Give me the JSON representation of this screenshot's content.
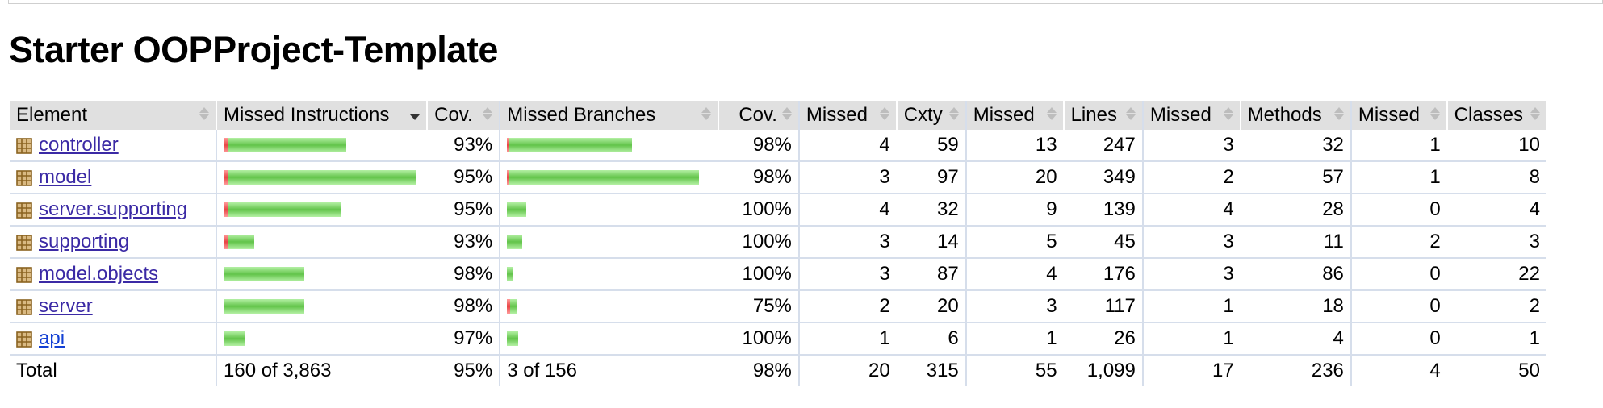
{
  "title": "Starter OOPProject-Template",
  "headers": {
    "element": "Element",
    "missed_instructions": "Missed Instructions",
    "cov1": "Cov.",
    "missed_branches": "Missed Branches",
    "cov2": "Cov.",
    "missed_cxty": "Missed",
    "cxty": "Cxty",
    "missed_lines": "Missed",
    "lines": "Lines",
    "missed_methods": "Missed",
    "methods": "Methods",
    "missed_classes": "Missed",
    "classes": "Classes"
  },
  "rows": [
    {
      "name": "controller",
      "instr_missed_frac": 0.06,
      "instr_total": 3863,
      "instr_cov": "93%",
      "br_missed_frac": 0.02,
      "br_total": 156,
      "br_cov": "98%",
      "missed_cxty": "4",
      "cxty": "59",
      "missed_lines": "13",
      "lines": "247",
      "missed_methods": "3",
      "methods": "32",
      "missed_classes": "1",
      "classes": "10"
    },
    {
      "name": "model",
      "instr_missed_frac": 0.05,
      "instr_total": 3863,
      "instr_cov": "95%",
      "br_missed_frac": 0.02,
      "br_total": 156,
      "br_cov": "98%",
      "missed_cxty": "3",
      "cxty": "97",
      "missed_lines": "20",
      "lines": "349",
      "missed_methods": "2",
      "methods": "57",
      "missed_classes": "1",
      "classes": "8"
    },
    {
      "name": "server.supporting",
      "instr_missed_frac": 0.05,
      "instr_total": 3863,
      "instr_cov": "95%",
      "br_missed_frac": 0.0,
      "br_total": 156,
      "br_cov": "100%",
      "missed_cxty": "4",
      "cxty": "32",
      "missed_lines": "9",
      "lines": "139",
      "missed_methods": "4",
      "methods": "28",
      "missed_classes": "0",
      "classes": "4"
    },
    {
      "name": "supporting",
      "instr_missed_frac": 0.07,
      "instr_total": 3863,
      "instr_cov": "93%",
      "br_missed_frac": 0.0,
      "br_total": 156,
      "br_cov": "100%",
      "missed_cxty": "3",
      "cxty": "14",
      "missed_lines": "5",
      "lines": "45",
      "missed_methods": "3",
      "methods": "11",
      "missed_classes": "2",
      "classes": "3"
    },
    {
      "name": "model.objects",
      "instr_missed_frac": 0.02,
      "instr_total": 3863,
      "instr_cov": "98%",
      "br_missed_frac": 0.0,
      "br_total": 156,
      "br_cov": "100%",
      "missed_cxty": "3",
      "cxty": "87",
      "missed_lines": "4",
      "lines": "176",
      "missed_methods": "3",
      "methods": "86",
      "missed_classes": "0",
      "classes": "22"
    },
    {
      "name": "server",
      "instr_missed_frac": 0.02,
      "instr_total": 3863,
      "instr_cov": "98%",
      "br_missed_frac": 0.25,
      "br_total": 156,
      "br_cov": "75%",
      "missed_cxty": "2",
      "cxty": "20",
      "missed_lines": "3",
      "lines": "117",
      "missed_methods": "1",
      "methods": "18",
      "missed_classes": "0",
      "classes": "2"
    },
    {
      "name": "api",
      "instr_missed_frac": 0.03,
      "instr_total": 3863,
      "instr_cov": "97%",
      "br_missed_frac": 0.0,
      "br_total": 156,
      "br_cov": "100%",
      "missed_cxty": "1",
      "cxty": "6",
      "missed_lines": "1",
      "lines": "26",
      "missed_methods": "1",
      "methods": "4",
      "missed_classes": "0",
      "classes": "1",
      "link_color": "blue"
    }
  ],
  "total": {
    "label": "Total",
    "instr": "160 of 3,863",
    "instr_cov": "95%",
    "br": "3 of 156",
    "br_cov": "98%",
    "missed_cxty": "20",
    "cxty": "315",
    "missed_lines": "55",
    "lines": "1,099",
    "missed_methods": "17",
    "methods": "236",
    "missed_classes": "4",
    "classes": "50"
  },
  "bar_levels": {
    "instructions_fraction_of_max": [
      0.64,
      1.0,
      0.61,
      0.16,
      0.42,
      0.42,
      0.11
    ],
    "branches_fraction_of_max": [
      0.65,
      1.0,
      0.1,
      0.08,
      0.03,
      0.05,
      0.06
    ]
  },
  "colors": {
    "covered": "#62c44a",
    "missed": "#e84444",
    "header_bg": "#e0e0e0",
    "link": "#3b2aa5"
  }
}
